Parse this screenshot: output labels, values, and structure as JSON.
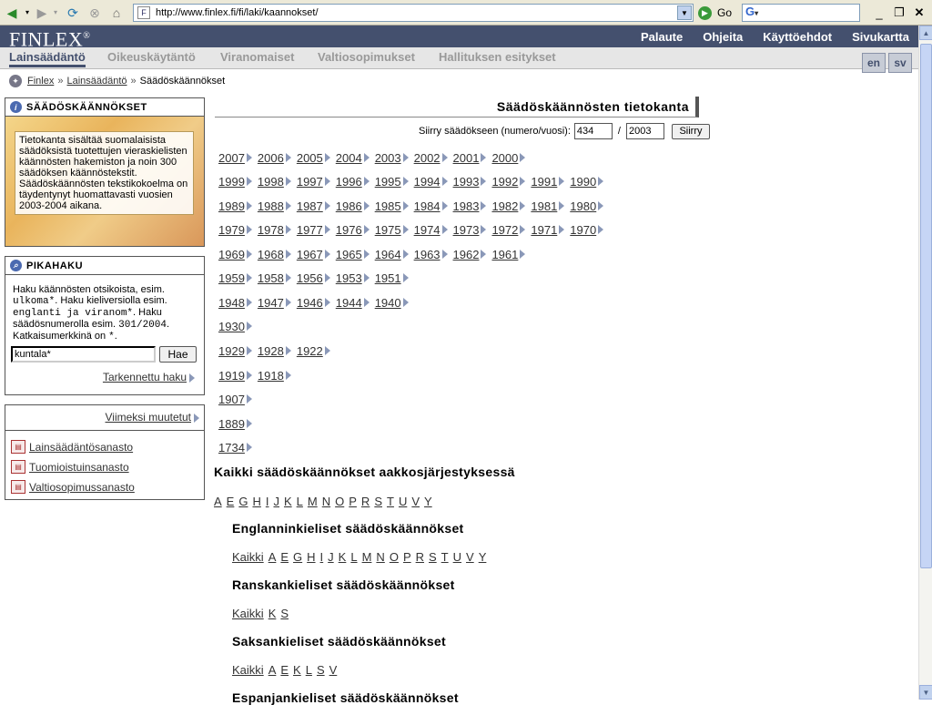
{
  "browser": {
    "url": "http://www.finlex.fi/fi/laki/kaannokset/",
    "go_label": "Go",
    "search_logo": "G"
  },
  "header": {
    "logo": "FINLEX",
    "logo_mark": "®",
    "links": [
      "Palaute",
      "Ohjeita",
      "Käyttöehdot",
      "Sivukartta"
    ]
  },
  "tabs": [
    "Lainsäädäntö",
    "Oikeuskäytäntö",
    "Viranomaiset",
    "Valtiosopimukset",
    "Hallituksen esitykset"
  ],
  "active_tab": "Lainsäädäntö",
  "languages": [
    "en",
    "sv"
  ],
  "breadcrumb": [
    "Finlex",
    "Lainsäädäntö",
    "Säädöskäännökset"
  ],
  "sidebar": {
    "info_title": "SÄÄDÖSKÄÄNNÖKSET",
    "info_text": "Tietokanta sisältää suomalaisista säädöksistä tuotettujen vieraskielisten käännösten hakemiston ja noin 300 säädöksen käännöstekstit. Säädöskäännösten tekstikokoelma on täydentynyt huomattavasti vuosien 2003-2004 aikana.",
    "quick_title": "PIKAHAKU",
    "quick_text_parts": [
      "Haku käännösten otsikoista, esim. ",
      "ulkoma*",
      ". Haku kieliversiolla esim. ",
      "englanti ja viranom*",
      ". Haku säädösnumerolla esim. ",
      "301/2004",
      ". Katkaisumerkkinä on ",
      "*",
      "."
    ],
    "quick_input_value": "kuntala*",
    "quick_button": "Hae",
    "advanced_link": "Tarkennettu haku",
    "recent_link": "Viimeksi muutetut",
    "vocabularies": [
      "Lainsäädäntösanasto",
      "Tuomioistuinsanasto",
      "Valtiosopimussanasto"
    ]
  },
  "main": {
    "title": "Säädöskäännösten tietokanta",
    "jump_label": "Siirry säädökseen (numero/vuosi):",
    "jump_number": "434",
    "jump_year": "2003",
    "jump_button": "Siirry",
    "year_rows": [
      [
        "2007",
        "2006",
        "2005",
        "2004",
        "2003",
        "2002",
        "2001",
        "2000"
      ],
      [
        "1999",
        "1998",
        "1997",
        "1996",
        "1995",
        "1994",
        "1993",
        "1992",
        "1991",
        "1990"
      ],
      [
        "1989",
        "1988",
        "1987",
        "1986",
        "1985",
        "1984",
        "1983",
        "1982",
        "1981",
        "1980"
      ],
      [
        "1979",
        "1978",
        "1977",
        "1976",
        "1975",
        "1974",
        "1973",
        "1972",
        "1971",
        "1970"
      ],
      [
        "1969",
        "1968",
        "1967",
        "1965",
        "1964",
        "1963",
        "1962",
        "1961"
      ],
      [
        "1959",
        "1958",
        "1956",
        "1953",
        "1951"
      ],
      [
        "1948",
        "1947",
        "1946",
        "1944",
        "1940"
      ],
      [
        "1930"
      ],
      [
        "1929",
        "1928",
        "1922"
      ],
      [
        "1919",
        "1918"
      ],
      [
        "1907"
      ],
      [
        "1889"
      ],
      [
        "1734"
      ]
    ],
    "all_heading": "Kaikki säädöskäännökset aakkosjärjestyksessä",
    "all_letters": [
      "A",
      "E",
      "G",
      "H",
      "I",
      "J",
      "K",
      "L",
      "M",
      "N",
      "O",
      "P",
      "R",
      "S",
      "T",
      "U",
      "V",
      "Y"
    ],
    "sections": [
      {
        "heading": "Englanninkieliset säädöskäännökset",
        "letters": [
          "Kaikki",
          "A",
          "E",
          "G",
          "H",
          "I",
          "J",
          "K",
          "L",
          "M",
          "N",
          "O",
          "P",
          "R",
          "S",
          "T",
          "U",
          "V",
          "Y"
        ]
      },
      {
        "heading": "Ranskankieliset säädöskäännökset",
        "letters": [
          "Kaikki",
          "K",
          "S"
        ]
      },
      {
        "heading": "Saksankieliset säädöskäännökset",
        "letters": [
          "Kaikki",
          "A",
          "E",
          "K",
          "L",
          "S",
          "V"
        ]
      },
      {
        "heading": "Espanjankieliset säädöskäännökset",
        "letters": []
      }
    ]
  }
}
